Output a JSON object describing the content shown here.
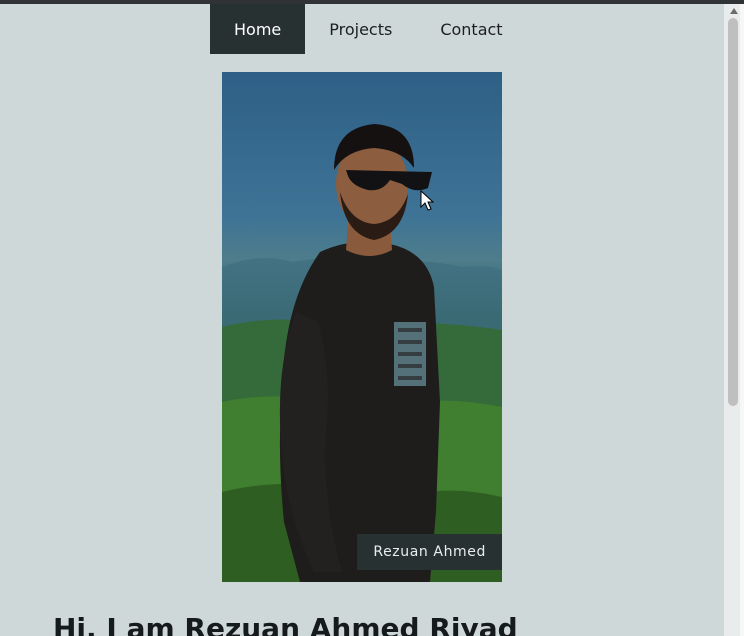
{
  "nav": {
    "items": [
      {
        "label": "Home",
        "active": true
      },
      {
        "label": "Projects",
        "active": false
      },
      {
        "label": "Contact",
        "active": false
      }
    ]
  },
  "hero": {
    "caption": "Rezuan Ahmed"
  },
  "intro": {
    "greeting": "Hi, I am Rezuan Ahmed Riyad"
  },
  "colors": {
    "nav_active": "#273132",
    "page_bg": "#cfd8d9"
  },
  "scrollbar": {
    "position_fraction": 0.0
  }
}
